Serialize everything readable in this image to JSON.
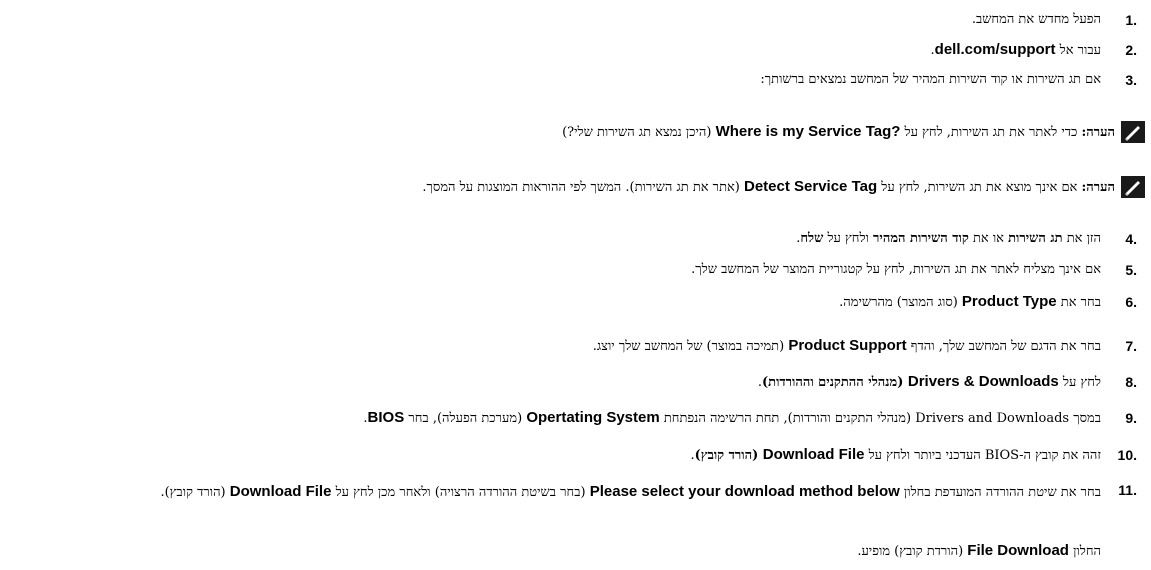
{
  "steps": [
    {
      "num": "1.",
      "text": "הפעל מחדש את המחשב."
    },
    {
      "num": "2.",
      "pre": "עבור אל ",
      "link": "dell.com/support",
      "post": "."
    },
    {
      "num": "3.",
      "text": "אם תג השירות או קוד השירות המהיר של המחשב נמצאים ברשותך:"
    },
    {
      "num": "4.",
      "pre": "הזן את ",
      "b1": "תג השירות",
      "mid": " או את ",
      "b2": "קוד השירות המהיר",
      "mid2": " ולחץ על ",
      "b3": "שלח",
      "post": "."
    },
    {
      "num": "5.",
      "text": "אם אינך מצליח לאתר את תג השירות, לחץ על קטגוריית המוצר של המחשב שלך."
    },
    {
      "num": "6.",
      "pre": "בחר את ",
      "bold": "Product Type",
      "post": " (סוג המוצר) מהרשימה."
    },
    {
      "num": "7.",
      "pre": "בחר את הדגם של המחשב שלך, והדף ",
      "bold": "Product Support",
      "post": " (תמיכה במוצר) של המחשב שלך יוצג."
    },
    {
      "num": "8.",
      "pre": "לחץ על ",
      "bold": "Drivers & Downloads",
      "bold2": " (מנהלי ההתקנים וההורדות)",
      "post": "."
    },
    {
      "num": "9.",
      "pre": "במסך Drivers and Downloads (מנהלי התקנים והורדות), תחת הרשימה הנפתחת ",
      "bold": "Opertating System",
      "mid": " (מערכת הפעלה), בחר ",
      "bold2": "BIOS",
      "post": "."
    },
    {
      "num": "10.",
      "pre": "זהה את קובץ ה-BIOS העדכני ביותר ולחץ על ",
      "bold": "Download File",
      "bold2": " (הורד קובץ)",
      "post": "."
    },
    {
      "num": "11.",
      "pre": "בחר את שיטת ההורדה המועדפת בחלון ",
      "bold": "Please select your download method below",
      "mid": " (בחר בשיטת ההורדה הרצויה) ולאחר מכן לחץ על ",
      "bold2": "Download File",
      "post": " (הורד קובץ)."
    }
  ],
  "notes": [
    {
      "label": "הערה:",
      "pre": " כדי לאתר את תג השירות, לחץ על ",
      "bold": "Where is my Service Tag?",
      "post": " (היכן נמצא תג השירות שלי?)"
    },
    {
      "label": "הערה:",
      "pre": " אם אינך מוצא את תג השירות, לחץ על ",
      "bold": "Detect Service Tag",
      "post": " (אתר את תג השירות). המשך לפי ההוראות המוצגות על המסך."
    }
  ],
  "footer": {
    "pre": "החלון ",
    "bold": "File Download",
    "post": " (הורדת קובץ) מופיע."
  },
  "icons": {
    "note": "pencil-note-icon"
  }
}
